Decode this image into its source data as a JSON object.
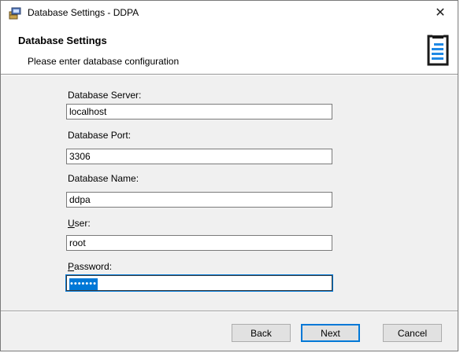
{
  "window": {
    "title": "Database Settings - DDPA",
    "close_glyph": "✕",
    "icon": "installer-icon"
  },
  "banner": {
    "title": "Database Settings",
    "subtitle": "Please enter database configuration",
    "logo": "document-logo-icon",
    "accent_color": "#1e88e5"
  },
  "form": {
    "server": {
      "label": "Database Server:",
      "value": "localhost"
    },
    "port": {
      "label": "Database Port:",
      "value": "3306"
    },
    "name": {
      "label": "Database Name:",
      "value": "ddpa"
    },
    "user": {
      "label_mnemonic": "U",
      "label_rest": "ser:",
      "value": "root"
    },
    "password": {
      "label_mnemonic": "P",
      "label_rest": "assword:",
      "value": "•••••••"
    }
  },
  "buttons": {
    "back": "Back",
    "next": "Next",
    "cancel": "Cancel"
  }
}
